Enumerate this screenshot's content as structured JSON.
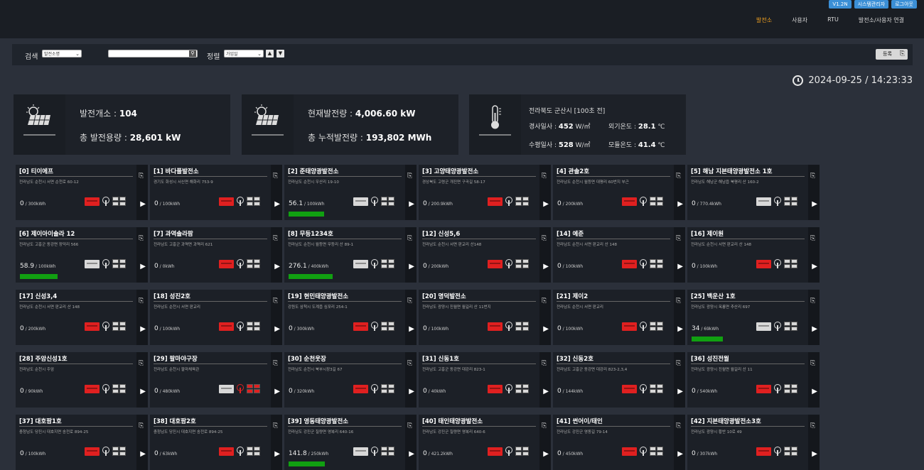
{
  "header": {
    "buttons": [
      "V1.2N",
      "시스템관리자",
      "로그아웃"
    ],
    "nav": [
      {
        "label": "발전소",
        "active": true
      },
      {
        "label": "사용자",
        "active": false
      },
      {
        "label": "RTU",
        "active": false
      },
      {
        "label": "발전소/사용자 연결",
        "active": false
      }
    ]
  },
  "search": {
    "label": "검색",
    "field_value": "발전소명",
    "input_value": "",
    "sort_label": "정렬",
    "sort_value": "가입일",
    "up": "▲",
    "down": "▼",
    "register_label": "등록"
  },
  "datetime": "2024-09-25 / 14:23:33",
  "summary": {
    "count_label": "발전개소 : ",
    "count_value": "104",
    "capacity_label": "총 발전용량 : ",
    "capacity_value": "28,601 kW",
    "current_label": "현재발전량 : ",
    "current_value": "4,006.60 kW",
    "total_label": "총 누적발전량 : ",
    "total_value": "193,802 MWh"
  },
  "weather": {
    "location": "전라북도 군산시 [100초 전]",
    "incline_label": "경사일사 : ",
    "incline_value": "452",
    "horizontal_label": "수평일사 : ",
    "horizontal_value": "528",
    "irr_unit": " W/㎡",
    "outside_label": "외기온도 : ",
    "outside_value": "28.1",
    "module_label": "모듈온도 : ",
    "module_value": "41.4",
    "temp_unit": " ℃"
  },
  "plants": [
    {
      "title": "[0] 티이에프",
      "addr": "전라남도 순천시 서면 순천로 60-12",
      "value": "0",
      "unit": " / 300kWh",
      "bar": 0,
      "inv": "red",
      "ant": "gray",
      "grid": "gray"
    },
    {
      "title": "[1] 바다풀발전소",
      "addr": "경기도 화성시 서신면 해화리 753-9",
      "value": "0",
      "unit": " / 100kWh",
      "bar": 0,
      "inv": "red",
      "ant": "gray",
      "grid": "gray"
    },
    {
      "title": "[2] 준태양광발전소",
      "addr": "전라남도 순천시 우산리 19-10",
      "value": "56.1",
      "unit": " / 100kWh",
      "bar": 0.56,
      "inv": "gray",
      "ant": "gray",
      "grid": "gray"
    },
    {
      "title": "[3] 고양태양광발전소",
      "addr": "경상북도 고령군 개진면 구곡길 58-17",
      "value": "0",
      "unit": " / 200.9kWh",
      "bar": 0,
      "inv": "red",
      "ant": "gray",
      "grid": "gray"
    },
    {
      "title": "[4] 관솔2호",
      "addr": "전라남도 순천시 월등면 대평리 60번지 부근",
      "value": "0",
      "unit": " / 200kWh",
      "bar": 0,
      "inv": "red",
      "ant": "gray",
      "grid": "gray"
    },
    {
      "title": "[5] 해남 지본태양광발전소 1호",
      "addr": "전라남도 해남군 해남읍 북평리 산 160-2",
      "value": "0",
      "unit": " / 770.4kWh",
      "bar": 0,
      "inv": "gray",
      "ant": "gray",
      "grid": "gray"
    },
    {
      "title": "[6] 제이아이솔라 12",
      "addr": "전라남도 고흥군 동강면 장덕리 566",
      "value": "58.9",
      "unit": " / 100kWh",
      "bar": 0.59,
      "inv": "gray",
      "ant": "gray",
      "grid": "gray"
    },
    {
      "title": "[7] 과역솔라팜",
      "addr": "전라남도 고흥군 과역면 과역리 621",
      "value": "0",
      "unit": " / 0kWh",
      "bar": 0,
      "inv": "red",
      "ant": "gray",
      "grid": "gray"
    },
    {
      "title": "[8] 무등1234호",
      "addr": "전라남도 순천시 월등면 무등리 산 89-1",
      "value": "276.1",
      "unit": " / 400kWh",
      "bar": 0.69,
      "inv": "gray",
      "ant": "gray",
      "grid": "gray"
    },
    {
      "title": "[12] 신성5,6",
      "addr": "전라남도 순천시 서면 판교리 산148",
      "value": "0",
      "unit": " / 200kWh",
      "bar": 0,
      "inv": "red",
      "ant": "gray",
      "grid": "gray"
    },
    {
      "title": "[14] 예준",
      "addr": "전라남도 순천시 서면 판교리 산 148",
      "value": "0",
      "unit": " / 100kWh",
      "bar": 0,
      "inv": "red",
      "ant": "gray",
      "grid": "gray"
    },
    {
      "title": "[16] 제이원",
      "addr": "전라남도 순천시 서면 판교리 산 148",
      "value": "0",
      "unit": " / 100kWh",
      "bar": 0,
      "inv": "red",
      "ant": "gray",
      "grid": "gray"
    },
    {
      "title": "[17] 신성3,4",
      "addr": "전라남도 순천시 서면 판교리 산 148",
      "value": "0",
      "unit": " / 200kWh",
      "bar": 0,
      "inv": "red",
      "ant": "gray",
      "grid": "gray"
    },
    {
      "title": "[18] 성진2호",
      "addr": "전라남도 순천시 서면 판교리",
      "value": "0",
      "unit": " / 100kWh",
      "bar": 0,
      "inv": "red",
      "ant": "gray",
      "grid": "gray"
    },
    {
      "title": "[19] 현민태양광발전소",
      "addr": "강원도 삼척시 도계읍 심포리 254-1",
      "value": "0",
      "unit": " / 300kWh",
      "bar": 0,
      "inv": "red",
      "ant": "gray",
      "grid": "gray"
    },
    {
      "title": "[20] 명덕발전소",
      "addr": "전라남도 광양시 진월면 월길리 산 11번지",
      "value": "0",
      "unit": " / 100kWh",
      "bar": 0,
      "inv": "red",
      "ant": "gray",
      "grid": "gray"
    },
    {
      "title": "[21] 제이2",
      "addr": "전라남도 순천시 서면 판교리",
      "value": "0",
      "unit": " / 100kWh",
      "bar": 0,
      "inv": "red",
      "ant": "gray",
      "grid": "gray"
    },
    {
      "title": "[25] 백운산 1호",
      "addr": "전라남도 광양시 옥룡면 추산리 697",
      "value": "34",
      "unit": " / 69kWh",
      "bar": 0.49,
      "inv": "gray",
      "ant": "gray",
      "grid": "gray"
    },
    {
      "title": "[28] 주암신성1호",
      "addr": "전라남도 순천시 주암",
      "value": "0",
      "unit": " / 90kWh",
      "bar": 0,
      "inv": "red",
      "ant": "gray",
      "grid": "gray"
    },
    {
      "title": "[29] 팔마야구장",
      "addr": "전라남도 순천시 팔마체육관",
      "value": "0",
      "unit": " / 480kWh",
      "bar": 0,
      "inv": "gray",
      "ant": "red",
      "grid": "red"
    },
    {
      "title": "[30] 순천웃장",
      "addr": "전라남도 순천시 북부시장3길 67",
      "value": "0",
      "unit": " / 320kWh",
      "bar": 0,
      "inv": "red",
      "ant": "gray",
      "grid": "gray"
    },
    {
      "title": "[31] 신동1호",
      "addr": "전라남도 고흥군 동강면 대강리 823-1",
      "value": "0",
      "unit": " / 40kWh",
      "bar": 0,
      "inv": "red",
      "ant": "gray",
      "grid": "gray"
    },
    {
      "title": "[32] 신동2호",
      "addr": "전라남도 고흥군 동강면 대강리 823-2,3,4",
      "value": "0",
      "unit": " / 144kWh",
      "bar": 0,
      "inv": "red",
      "ant": "gray",
      "grid": "gray"
    },
    {
      "title": "[36] 성진전월",
      "addr": "전라남도 광양시 진월면 월길리 산 11",
      "value": "0",
      "unit": " / 540kWh",
      "bar": 0,
      "inv": "red",
      "ant": "gray",
      "grid": "gray"
    },
    {
      "title": "[37] 대호팜1호",
      "addr": "충청남도 당진시 대호지면 송전로 894-25",
      "value": "0",
      "unit": " / 100kWh",
      "bar": 0,
      "inv": "red",
      "ant": "gray",
      "grid": "gray"
    },
    {
      "title": "[38] 대호팜2호",
      "addr": "충청남도 당진시 대호지면 송전로 894-25",
      "value": "0",
      "unit": " / 63kWh",
      "bar": 0,
      "inv": "red",
      "ant": "gray",
      "grid": "gray"
    },
    {
      "title": "[39] 영동태양광발전소",
      "addr": "전라남도 강진군 칠량면 영복리 640-16",
      "value": "141.8",
      "unit": " / 250kWh",
      "bar": 0.57,
      "inv": "gray",
      "ant": "gray",
      "grid": "gray"
    },
    {
      "title": "[40] 태인태양광발전소",
      "addr": "전라남도 강진군 칠량면 영복리 640-6",
      "value": "0",
      "unit": " / 421.2kWh",
      "bar": 0,
      "inv": "red",
      "ant": "gray",
      "grid": "gray"
    },
    {
      "title": "[41] 썬어이/태인",
      "addr": "전라남도 강진군 영동길 79-14",
      "value": "0",
      "unit": " / 450kWh",
      "bar": 0,
      "inv": "red",
      "ant": "gray",
      "grid": "gray"
    },
    {
      "title": "[42] 지본태양광발전소3호",
      "addr": "전라남도 광양시 황반 10로 49",
      "value": "0",
      "unit": " / 307kWh",
      "bar": 0,
      "inv": "red",
      "ant": "gray",
      "grid": "gray"
    }
  ]
}
